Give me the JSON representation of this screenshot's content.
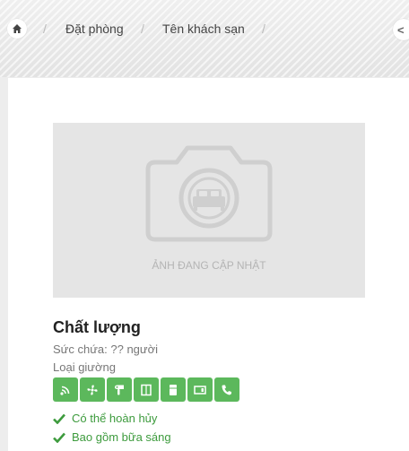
{
  "breadcrumb": {
    "home_icon": "home-icon",
    "items": [
      "Đặt phòng",
      "Tên khách sạn"
    ],
    "separator": "/"
  },
  "room": {
    "photo_caption": "ẢNH ĐANG CẬP NHẬT",
    "title": "Chất lượng",
    "capacity": "Sức chứa: ?? người",
    "bed_type": "Loại giường",
    "amenity_icons": [
      "wifi-icon",
      "fan-icon",
      "hair-dryer-icon",
      "wardrobe-icon",
      "fridge-icon",
      "tv-icon",
      "phone-icon"
    ],
    "perks": [
      "Có thể hoàn hủy",
      "Bao gồm bữa sáng"
    ]
  },
  "colors": {
    "accent_green": "#5cb85c",
    "perk_text": "#3d9b3d"
  }
}
